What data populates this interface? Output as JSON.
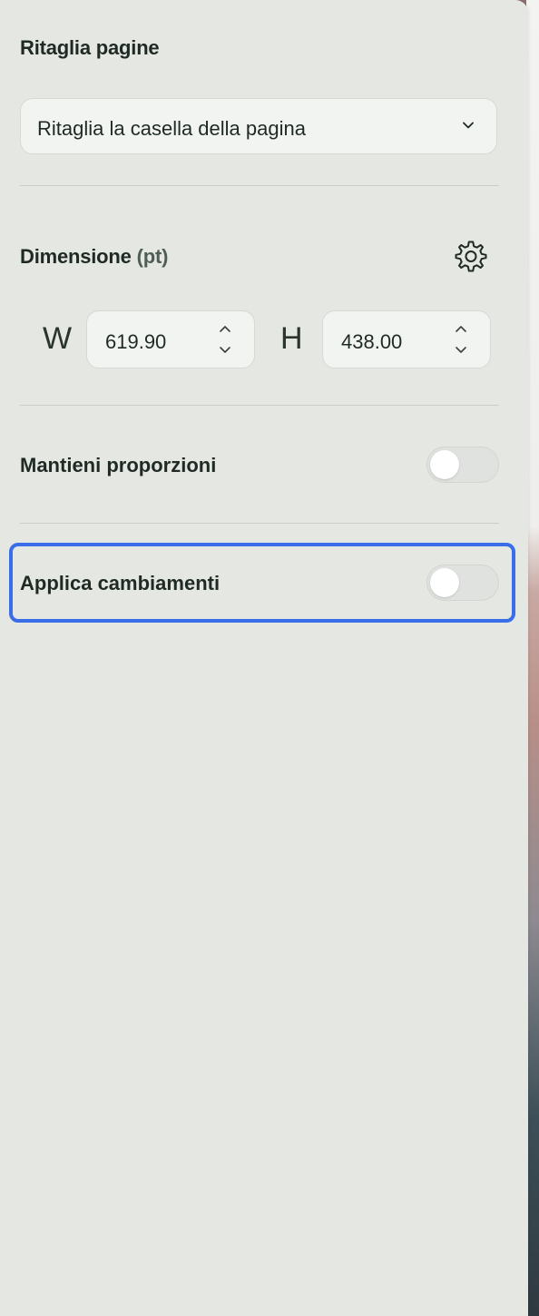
{
  "crop_section": {
    "title": "Ritaglia pagine",
    "dropdown_value": "Ritaglia la casella della pagina"
  },
  "dimension_section": {
    "title": "Dimensione",
    "unit": "(pt)",
    "width_label": "W",
    "width_value": "619.90",
    "height_label": "H",
    "height_value": "438.00"
  },
  "keep_proportions": {
    "label": "Mantieni proporzioni",
    "enabled": false
  },
  "apply_changes": {
    "label": "Applica cambiamenti",
    "enabled": false,
    "focused": true
  },
  "icons": {
    "dropdown": "chevron-down-icon",
    "settings": "gear-icon",
    "stepper_up": "chevron-up-icon",
    "stepper_down": "chevron-down-icon"
  },
  "colors": {
    "panel_background": "#e5e7e3",
    "focus_ring": "#3a6ee8",
    "text": "#1f2a24"
  }
}
